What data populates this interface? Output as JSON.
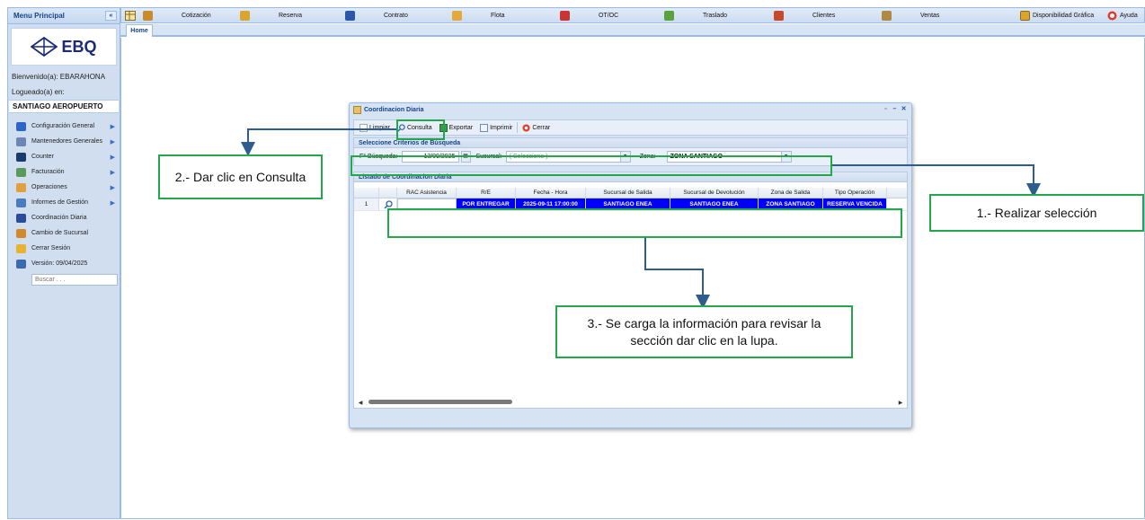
{
  "sidebar": {
    "title": "Menu Principal",
    "collapse_glyph": "«",
    "logo_text": "EBQ",
    "welcome": "Bienvenido(a): EBARAHONA",
    "logged_in_label": "Logueado(a) en:",
    "location": "SANTIAGO AEROPUERTO",
    "items": [
      {
        "label": "Configuración General",
        "icon": "gear-icon",
        "color": "#2a66c9",
        "has_sub": true
      },
      {
        "label": "Mantenedores Generales",
        "icon": "folder-icon",
        "color": "#6b86b5",
        "has_sub": true
      },
      {
        "label": "Counter",
        "icon": "car-icon",
        "color": "#1b3b6e",
        "has_sub": true
      },
      {
        "label": "Facturación",
        "icon": "invoice-icon",
        "color": "#5a9a5a",
        "has_sub": true
      },
      {
        "label": "Operaciones",
        "icon": "operations-icon",
        "color": "#e0a040",
        "has_sub": true
      },
      {
        "label": "Informes de Gestión",
        "icon": "report-icon",
        "color": "#4b7bc0",
        "has_sub": true
      },
      {
        "label": "Coordinación Diaria",
        "icon": "users-icon",
        "color": "#2a4c9a",
        "has_sub": false
      },
      {
        "label": "Cambio de Sucursal",
        "icon": "switch-icon",
        "color": "#d08a2a",
        "has_sub": false
      },
      {
        "label": "Cerrar Sesión",
        "icon": "lock-icon",
        "color": "#e8b330",
        "has_sub": false
      },
      {
        "label": "Versión: 09/04/2025",
        "icon": "calendar-icon",
        "color": "#3a6ab0",
        "has_sub": false
      }
    ],
    "search_placeholder": "Buscar . . ."
  },
  "toolbar": {
    "items": [
      {
        "label": "Cotización",
        "icon": "quote-icon",
        "color": "#c98b2b"
      },
      {
        "label": "Reserva",
        "icon": "reservation-icon",
        "color": "#d9a52c"
      },
      {
        "label": "Contrato",
        "icon": "contract-icon",
        "color": "#2c56a8"
      },
      {
        "label": "Flota",
        "icon": "fleet-icon",
        "color": "#e3a93a"
      },
      {
        "label": "OT/OC",
        "icon": "order-icon",
        "color": "#cc3333"
      },
      {
        "label": "Traslado",
        "icon": "transfer-icon",
        "color": "#5aa23a"
      },
      {
        "label": "Clientes",
        "icon": "clients-icon",
        "color": "#c84a2a"
      },
      {
        "label": "Ventas",
        "icon": "sales-icon",
        "color": "#b08a40"
      }
    ],
    "availability_label": "Disponibilidad Gráfica",
    "help_label": "Ayuda"
  },
  "tabs": {
    "home": "Home"
  },
  "dialog": {
    "title": "Coordinacion Diaria",
    "buttons": {
      "clear": "Limpiar",
      "search": "Consulta",
      "export": "Exportar",
      "print": "Imprimir",
      "close": "Cerrar"
    },
    "criteria_title": "Seleccione Criterios de Búsqueda",
    "filters": {
      "date_label": "F° Búsqueda:",
      "date_value": "13/09/2025",
      "branch_label": "Sucursal:",
      "branch_placeholder": "( Seleccione )",
      "zone_label": "Zona:",
      "zone_value": "ZONA SANTIAGO"
    },
    "list_title": "Listado de Coordinacion Diaria",
    "grid": {
      "columns": [
        "",
        "",
        "RAC Asistencia",
        "R/E",
        "Fecha - Hora",
        "Sucursal de Salida",
        "Sucursal de Devolución",
        "Zona de Salida",
        "Tipo Operación"
      ],
      "rows": [
        {
          "num": "1",
          "rac": "",
          "re": "POR ENTREGAR",
          "datetime": "2025-09-11 17:00:00",
          "branch_out": "SANTIAGO ENEA",
          "branch_return": "SANTIAGO ENEA",
          "zone": "ZONA SANTIAGO",
          "operation": "RESERVA VENCIDA"
        }
      ]
    }
  },
  "callouts": {
    "step1": "1.- Realizar selección",
    "step2": "2.- Dar clic en Consulta",
    "step3": "3.- Se carga la información para revisar la sección dar clic en la lupa."
  },
  "colors": {
    "annotation_green": "#22a84a",
    "arrow_blue": "#2f5c8f",
    "selected_row": "#0000ff"
  }
}
